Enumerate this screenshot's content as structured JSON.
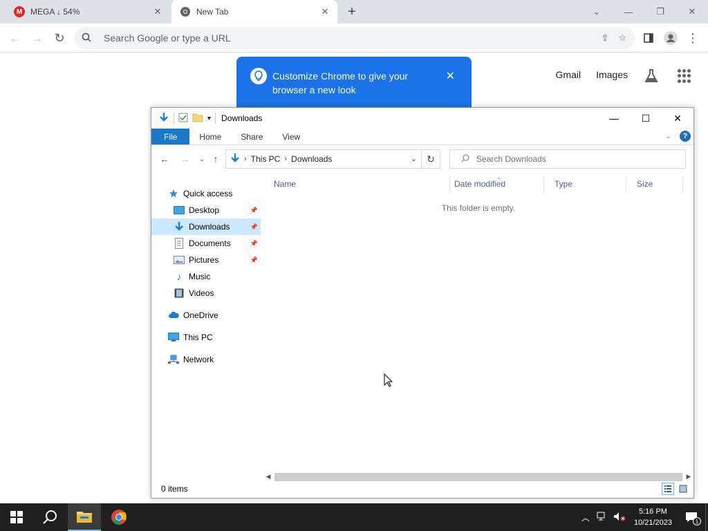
{
  "chrome": {
    "tabs": [
      {
        "title": "MEGA ↓ 54%"
      },
      {
        "title": "New Tab"
      }
    ],
    "omnibox_placeholder": "Search Google or type a URL",
    "ntp_links": {
      "gmail": "Gmail",
      "images": "Images"
    },
    "customize_message": "Customize Chrome to give your browser a new look"
  },
  "explorer": {
    "title": "Downloads",
    "ribbon_tabs": [
      "File",
      "Home",
      "Share",
      "View"
    ],
    "breadcrumb": [
      "This PC",
      "Downloads"
    ],
    "search_placeholder": "Search Downloads",
    "nav": {
      "quick_access": "Quick access",
      "pinned": [
        "Desktop",
        "Downloads",
        "Documents",
        "Pictures"
      ],
      "other": [
        "Music",
        "Videos"
      ],
      "onedrive": "OneDrive",
      "this_pc": "This PC",
      "network": "Network"
    },
    "columns": [
      "Name",
      "Date modified",
      "Type",
      "Size"
    ],
    "empty_message": "This folder is empty.",
    "status": "0 items"
  },
  "taskbar": {
    "time": "5:16 PM",
    "date": "10/21/2023",
    "notification_count": "1"
  },
  "colors": {
    "accent_blue": "#1a73e8",
    "file_tab": "#1979ca",
    "selected_nav": "#cce8ff",
    "taskbar": "#1f1f1f"
  }
}
